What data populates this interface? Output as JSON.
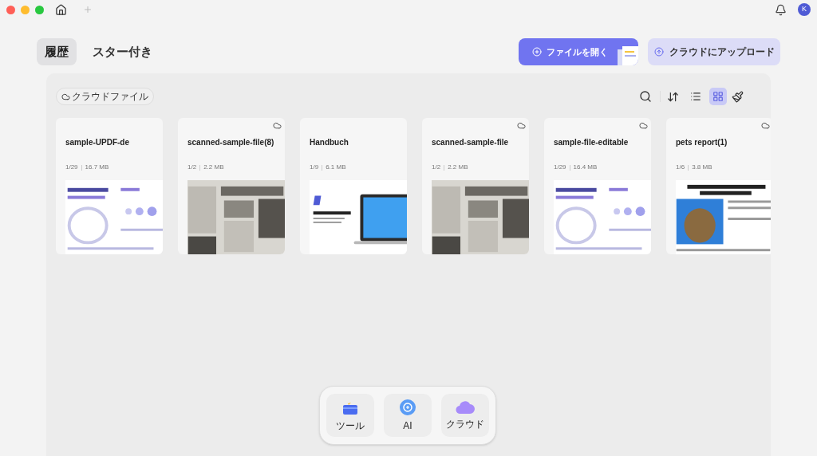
{
  "tabs": [
    {
      "label": "履歴",
      "selected": true
    },
    {
      "label": "スター付き",
      "selected": false
    }
  ],
  "actions": [
    {
      "label": "ファイルを開く",
      "kind": "primary"
    },
    {
      "label": "クラウドにアップロード",
      "kind": "secondary"
    }
  ],
  "filter": {
    "label": "クラウドファイル"
  },
  "view_modes": [
    {
      "kind": "list",
      "selected": false
    },
    {
      "kind": "grid",
      "selected": true
    }
  ],
  "files": [
    {
      "name": "sample-UPDF-de",
      "pages": "1/29",
      "size": "16.7 MB",
      "cloud": false,
      "kind": "science"
    },
    {
      "name": "scanned-sample-file(8)",
      "pages": "1/2",
      "size": "2.2 MB",
      "cloud": true,
      "kind": "newspaper"
    },
    {
      "name": "Handbuch",
      "pages": "1/9",
      "size": "6.1 MB",
      "cloud": false,
      "kind": "welcome"
    },
    {
      "name": "scanned-sample-file",
      "pages": "1/2",
      "size": "2.2 MB",
      "cloud": true,
      "kind": "newspaper"
    },
    {
      "name": "sample-file-editable",
      "pages": "1/29",
      "size": "16.4 MB",
      "cloud": true,
      "kind": "science"
    },
    {
      "name": "pets report(1)",
      "pages": "1/6",
      "size": "3.8 MB",
      "cloud": true,
      "kind": "pets"
    }
  ],
  "dock": [
    {
      "label": "ツール",
      "kind": "tools"
    },
    {
      "label": "AI",
      "kind": "ai"
    },
    {
      "label": "クラウド",
      "kind": "cloud"
    }
  ],
  "avatar": "K"
}
